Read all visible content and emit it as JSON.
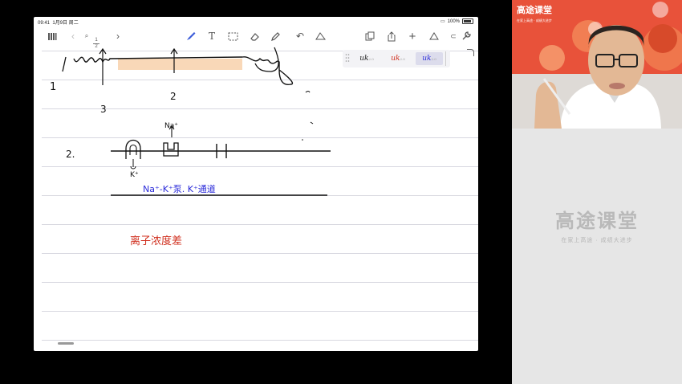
{
  "status": {
    "time": "09:41",
    "date": "1月9日 周二",
    "battery": "100%"
  },
  "toolbar": {
    "page_current": "1",
    "page_total": "2"
  },
  "pens": [
    "uk",
    "uk",
    "uk"
  ],
  "pen_sizes": [
    "2.0",
    "2.0",
    "2.0"
  ],
  "handwriting": {
    "num1": "1",
    "label2": "2",
    "label3": "3",
    "item2": "2.",
    "na": "Na⁺",
    "k": "K⁺",
    "pump_note": "Na⁺-K⁺泵. K⁺通道",
    "ion_note": "离子浓度差"
  },
  "colors": {
    "blue_ink": "#2b2bd9",
    "red_ink": "#d0301f",
    "orange_bg": "#e8523a",
    "pen_blue": "#3a5bd9"
  },
  "brand": {
    "name": "高途课堂",
    "slogan": "在家上高途 · 成绩大进步",
    "cam_name": "高途课堂",
    "cam_slogan": "在家上高途 · 成绩大进步"
  }
}
